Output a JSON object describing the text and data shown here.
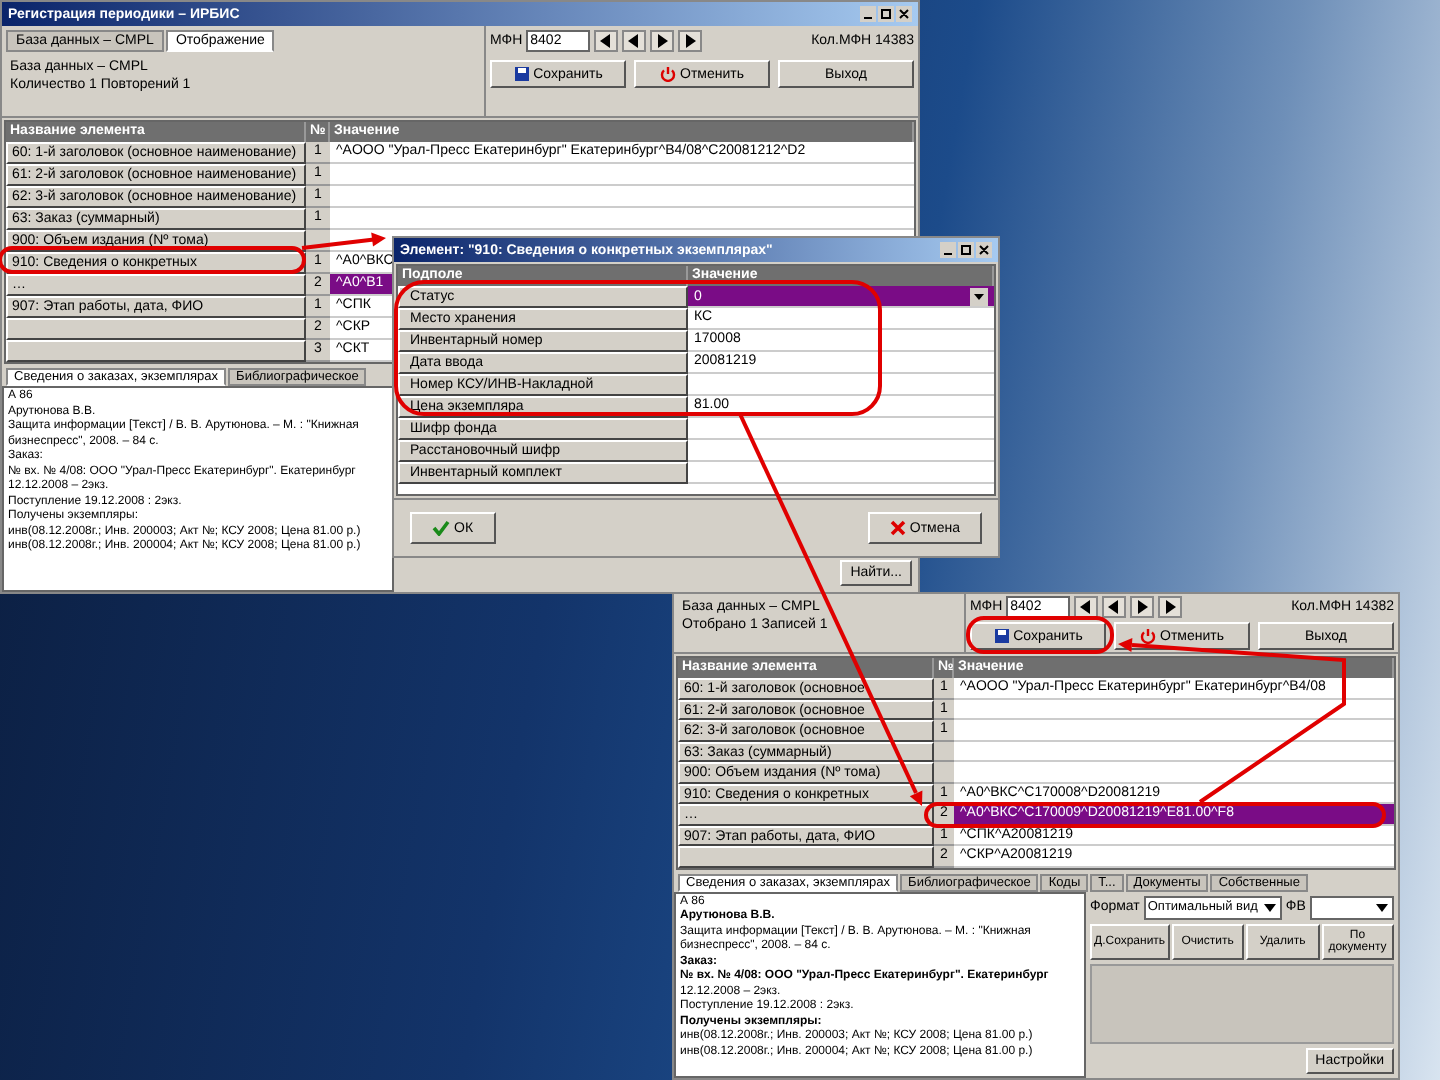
{
  "main_window": {
    "title": "Регистрация периодики – ИРБИС",
    "tabs": [
      {
        "label": "База данных – CMPL",
        "selected": false
      },
      {
        "label": "Отображение",
        "selected": true
      }
    ],
    "info": [
      "База данных – CMPL",
      "Количество 1        Повторений 1"
    ],
    "mfn_label": "МФН",
    "mfn_value": "8402",
    "count": "Кол.МФН 14383",
    "buttons": [
      {
        "label": "Сохранить",
        "kind": "save"
      },
      {
        "label": "Отменить",
        "kind": "cancel"
      },
      {
        "label": "Выход",
        "kind": "exit"
      }
    ],
    "columns": [
      "Название элемента",
      "№",
      "Значение"
    ],
    "rows": [
      {
        "name": "60: 1-й заголовок (основное наименование)",
        "number": "1",
        "value": "^AООО \"Урал-Пресс Екатеринбург\" Екатеринбург^B4/08^C20081212^D2",
        "selected": false
      },
      {
        "name": "61: 2-й заголовок (основное наименование)",
        "number": "1",
        "value": "",
        "selected": false
      },
      {
        "name": "62: 3-й заголовок (основное наименование)",
        "number": "1",
        "value": "",
        "selected": false
      },
      {
        "name": "63: Заказ (суммарный)",
        "number": "1",
        "value": "",
        "selected": false
      },
      {
        "name": "900: Объем издания (Nº тома)",
        "number": "",
        "value": "",
        "selected": false
      },
      {
        "name": "910: Сведения о конкретных",
        "number": "1",
        "value": "^A0^BКС",
        "selected": false
      },
      {
        "name": "…",
        "number": "2",
        "value": "^A0^B1",
        "selected": true
      },
      {
        "name": "907: Этап работы, дата, ФИО",
        "number": "1",
        "value": "^CПК",
        "selected": false
      },
      {
        "name": "",
        "number": "2",
        "value": "^CКР",
        "selected": false
      },
      {
        "name": "",
        "number": "3",
        "value": "^CКТ",
        "selected": false
      }
    ],
    "bottom_tabs": [
      {
        "label": "Сведения о заказах, экземплярах",
        "selected": true
      },
      {
        "label": "Библиографическое",
        "selected": false
      }
    ],
    "description": [
      "А 86",
      "Арутюнова В.В.",
      "Защита информации [Текст] / В. В. Арутюнова. – М. : \"Книжная бизнеспресс\", 2008. – 84 с.",
      "Заказ:",
      "№ вх. № 4/08: ООО \"Урал-Пресс Екатеринбург\". Екатеринбург 12.12.2008 – 2экз.",
      "Поступление 19.12.2008 : 2экз.",
      "Получены экземпляры:",
      "инв(08.12.2008г.; Инв. 200003; Акт №; КСУ 2008; Цена 81.00 р.)",
      "инв(08.12.2008г.; Инв. 200004; Акт №; КСУ 2008; Цена 81.00 р.)"
    ],
    "find_button": "Найти..."
  },
  "element_dialog": {
    "title": "Элемент: \"910: Сведения о конкретных экземплярах\"",
    "columns": [
      "Подполе",
      "Значение"
    ],
    "rows": [
      {
        "name": "Статус",
        "value": "0",
        "selected": true
      },
      {
        "name": "Место хранения",
        "value": "КС",
        "selected": false
      },
      {
        "name": "Инвентарный номер",
        "value": "170008",
        "selected": false
      },
      {
        "name": "Дата ввода",
        "value": "20081219",
        "selected": false
      },
      {
        "name": "Номер КСУ/ИНВ-Накладной",
        "value": "",
        "selected": false
      },
      {
        "name": "Цена экземпляра",
        "value": "81.00",
        "selected": false
      },
      {
        "name": "Шифр фонда",
        "value": "",
        "selected": false
      },
      {
        "name": "Расстановочный шифр",
        "value": "",
        "selected": false
      },
      {
        "name": "Инвентарный комплект",
        "value": "",
        "selected": false
      }
    ],
    "buttons": [
      {
        "label": "ОК",
        "kind": "ok"
      },
      {
        "label": "Отмена",
        "kind": "cancel"
      }
    ]
  },
  "second_window": {
    "info": [
      "База данных – CMPL",
      "Отобрано 1        Записей 1"
    ],
    "mfn_label": "МФН",
    "mfn_value": "8402",
    "count": "Кол.МФН 14382",
    "buttons": [
      {
        "label": "Сохранить",
        "kind": "save"
      },
      {
        "label": "Отменить",
        "kind": "cancel"
      },
      {
        "label": "Выход",
        "kind": "exit"
      }
    ],
    "columns": [
      "Название элемента",
      "№",
      "Значение"
    ],
    "rows": [
      {
        "name": "60: 1-й заголовок (основное",
        "number": "1",
        "value": "^AООО \"Урал-Пресс Екатеринбург\" Екатеринбург^B4/08",
        "selected": false
      },
      {
        "name": "61: 2-й заголовок (основное",
        "number": "1",
        "value": "",
        "selected": false
      },
      {
        "name": "62: 3-й заголовок (основное",
        "number": "1",
        "value": "",
        "selected": false
      },
      {
        "name": "63: Заказ (суммарный)",
        "number": "",
        "value": "",
        "selected": false
      },
      {
        "name": "900: Объем издания (Nº тома)",
        "number": "",
        "value": "",
        "selected": false
      },
      {
        "name": "910: Сведения о конкретных",
        "number": "1",
        "value": "^A0^BКС^C170008^D20081219",
        "selected": false
      },
      {
        "name": "…",
        "number": "2",
        "value": "^A0^BКС^C170009^D20081219^E81.00^F8",
        "selected": true
      },
      {
        "name": "907: Этап работы, дата, ФИО",
        "number": "1",
        "value": "^CПК^A20081219",
        "selected": false
      },
      {
        "name": "",
        "number": "2",
        "value": "^CКР^A20081219",
        "selected": false
      }
    ],
    "bottom_tabs": [
      {
        "label": "Сведения о заказах, экземплярах",
        "selected": true
      },
      {
        "label": "Библиографическое",
        "selected": false
      },
      {
        "label": "Коды",
        "selected": false
      },
      {
        "label": "Т...",
        "selected": false
      },
      {
        "label": "Документы",
        "selected": false
      },
      {
        "label": "Собственные",
        "selected": false
      }
    ],
    "description": [
      "А 86",
      "Арутюнова В.В.",
      "Защита информации [Текст] / В. В. Арутюнова. – М. : \"Книжная бизнеспресс\", 2008. – 84 с.",
      "Заказ:",
      "№ вх. № 4/08: ООО \"Урал-Пресс Екатеринбург\". Екатеринбург",
      "12.12.2008 – 2экз.",
      "Поступление 19.12.2008 : 2экз.",
      "Получены экземпляры:",
      "инв(08.12.2008г.; Инв. 200003; Акт №; КСУ 2008; Цена 81.00 р.)",
      "инв(08.12.2008г.; Инв. 200004; Акт №; КСУ 2008; Цена 81.00 р.)"
    ],
    "format_label": "Формат",
    "format_value": "Оптимальный вид",
    "fv_label": "ФВ",
    "tools": [
      "Д.Сохранить",
      "Очистить",
      "Удалить",
      "По документу"
    ],
    "settings_button": "Настройки"
  }
}
